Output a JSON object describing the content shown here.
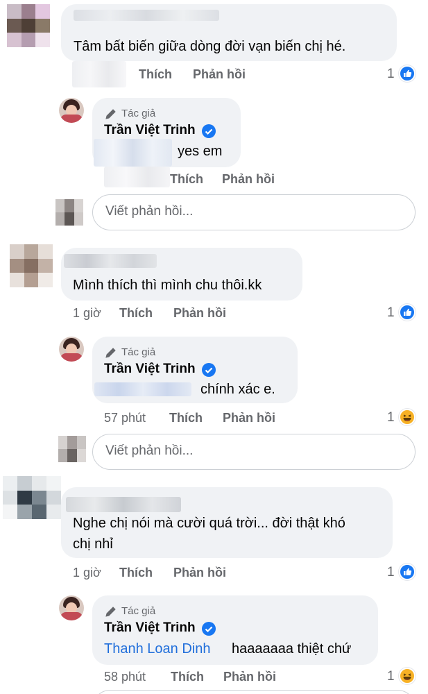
{
  "comments": [
    {
      "text": "Tâm bất biến giữa dòng đời  vạn biến chị hé.",
      "actions": {
        "like": "Thích",
        "reply": "Phản hồi"
      },
      "reaction_count": "1",
      "reaction_icon": "like-icon",
      "reply": {
        "author_tag": "Tác giả",
        "author_name": "Trần Việt Trinh",
        "text": "yes em",
        "actions": {
          "like": "Thích",
          "reply": "Phản hồi"
        }
      },
      "reply_placeholder": "Viết phản hồi..."
    },
    {
      "text": "Mình thích thì mình chu thôi.kk",
      "time": "1 giờ",
      "actions": {
        "like": "Thích",
        "reply": "Phản hồi"
      },
      "reaction_count": "1",
      "reaction_icon": "like-icon",
      "reply": {
        "author_tag": "Tác giả",
        "author_name": "Trần Việt Trinh",
        "text": "chính xác e.",
        "time": "57 phút",
        "actions": {
          "like": "Thích",
          "reply": "Phản hồi"
        },
        "reaction_count": "1",
        "reaction_icon": "haha-icon"
      },
      "reply_placeholder": "Viết phản hồi..."
    },
    {
      "text_line1": "Nghe chị nói mà cười quá trời... đời thật khó",
      "text_line2": "chị nhỉ",
      "time": "1 giờ",
      "actions": {
        "like": "Thích",
        "reply": "Phản hồi"
      },
      "reaction_count": "1",
      "reaction_icon": "like-icon",
      "reply": {
        "author_tag": "Tác giả",
        "author_name": "Trần Việt Trinh",
        "mention": "Thanh Loan Dinh",
        "text": "haaaaaaa thiệt chứ",
        "time": "58 phút",
        "actions": {
          "like": "Thích",
          "reply": "Phản hồi"
        },
        "reaction_count": "1",
        "reaction_icon": "haha-icon"
      }
    }
  ],
  "colors": {
    "bubble": "#f0f2f5",
    "meta_text": "#65676b",
    "link_blue": "#216fdb",
    "like_blue": "#1877f2",
    "haha_yellow": "#f7b125"
  }
}
